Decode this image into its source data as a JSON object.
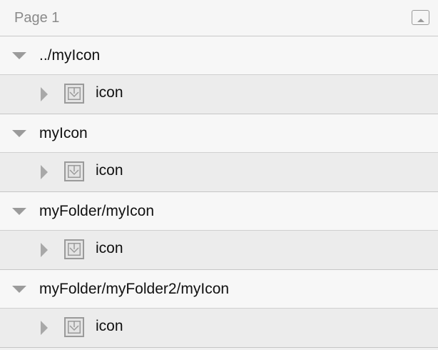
{
  "header": {
    "title": "Page 1",
    "collapse_icon": "collapse-panel-icon"
  },
  "groups": [
    {
      "label": "../myIcon",
      "child": {
        "label": "icon",
        "icon": "symbol-icon"
      }
    },
    {
      "label": "myIcon",
      "child": {
        "label": "icon",
        "icon": "symbol-icon"
      }
    },
    {
      "label": "myFolder/myIcon",
      "child": {
        "label": "icon",
        "icon": "symbol-icon"
      }
    },
    {
      "label": "myFolder/myFolder2/myIcon",
      "child": {
        "label": "icon",
        "icon": "symbol-icon"
      }
    }
  ],
  "colors": {
    "header_bg": "#f6f6f6",
    "group_bg": "#f7f7f7",
    "child_bg": "#ececec",
    "text": "#111111",
    "muted": "#8a8a8a"
  }
}
